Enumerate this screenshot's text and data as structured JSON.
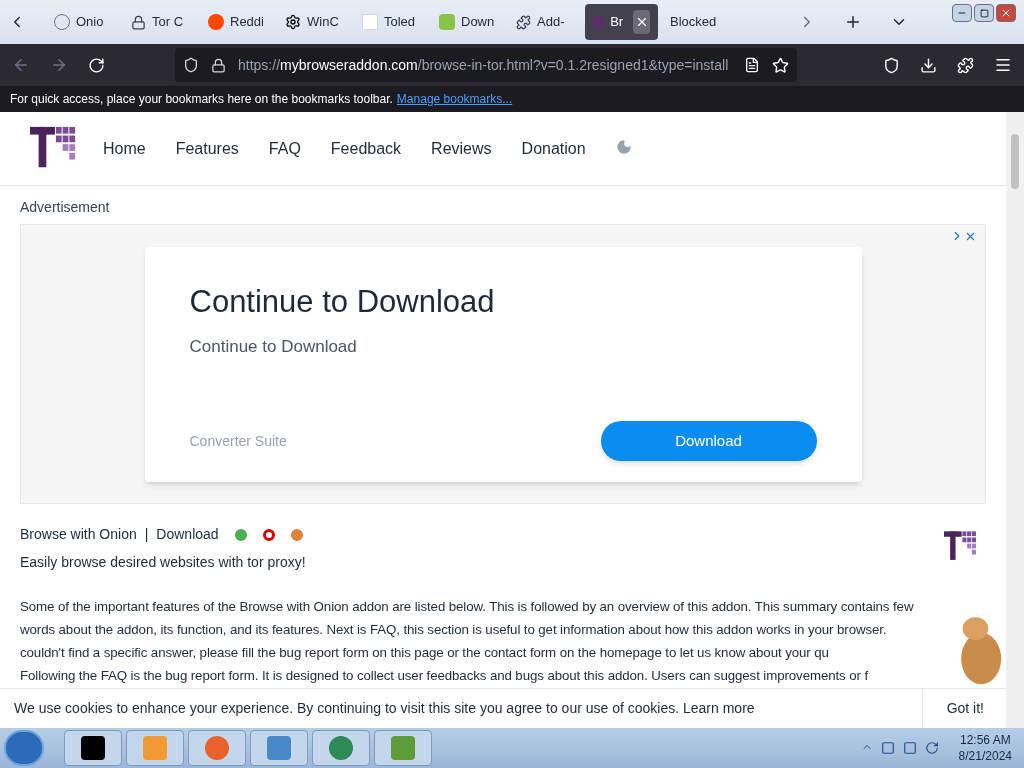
{
  "tabs": [
    {
      "label": "Onio",
      "selected": false
    },
    {
      "label": "Tor C",
      "selected": false
    },
    {
      "label": "Reddi",
      "selected": false
    },
    {
      "label": "WinC",
      "selected": false
    },
    {
      "label": "Toled",
      "selected": false
    },
    {
      "label": "Down",
      "selected": false
    },
    {
      "label": "Add-",
      "selected": false
    },
    {
      "label": "Br",
      "selected": true
    },
    {
      "label": "Blocked",
      "selected": false
    }
  ],
  "address": {
    "prefix": "https://",
    "domain": "mybrowseraddon.com",
    "path": "/browse-in-tor.html?v=0.1.2resigned1&type=install"
  },
  "bookmarks_bar": {
    "text": "For quick access, place your bookmarks here on the bookmarks toolbar.",
    "link": "Manage bookmarks..."
  },
  "site_nav": [
    "Home",
    "Features",
    "FAQ",
    "Feedback",
    "Reviews",
    "Donation"
  ],
  "ad": {
    "label": "Advertisement",
    "title": "Continue to Download",
    "subtitle": "Continue to Download",
    "sponsor": "Converter Suite",
    "button": "Download"
  },
  "addon": {
    "name": "Browse with Onion",
    "separator": "|",
    "download": "Download",
    "tagline": "Easily browse desired websites with tor proxy!"
  },
  "paragraph_lines": [
    "Some of the important features of the Browse with Onion addon are listed below. This is followed by an overview of this addon. This summary contains few",
    "words about the addon, its function, and its features. Next is FAQ, this section is useful to get information about how this addon works in your browser.",
    "couldn't find a specific answer, please fill the bug report form on this page or the contact form on the homepage to let us know about your qu",
    "Following the FAQ is the bug report form. It is designed to collect user feedbacks and bugs about this addon. Users can suggest improvements or f"
  ],
  "cookie": {
    "text": "We use cookies to enhance your experience. By continuing to visit this site you agree to our use of cookies.",
    "link": "Learn more",
    "button": "Got it!"
  },
  "clock": {
    "time": "12:56 AM",
    "date": "8/21/2024"
  }
}
